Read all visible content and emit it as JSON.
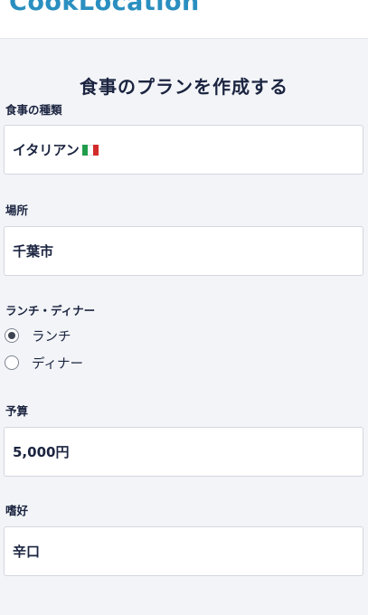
{
  "app": {
    "brand": "CookLocation"
  },
  "page": {
    "title": "食事のプランを作成する"
  },
  "form": {
    "cuisine": {
      "label": "食事の種類",
      "value": "イタリアン",
      "flag_icon": "italy-flag-icon"
    },
    "location": {
      "label": "場所",
      "value": "千葉市"
    },
    "meal_time": {
      "label": "ランチ・ディナー",
      "options": [
        {
          "label": "ランチ",
          "selected": true
        },
        {
          "label": "ディナー",
          "selected": false
        }
      ]
    },
    "budget": {
      "label": "予算",
      "value": "5,000円"
    },
    "preference": {
      "label": "嗜好",
      "value": "辛口"
    }
  },
  "colors": {
    "brand": "#2a8fc0",
    "background": "#f2f4f7",
    "text": "#1b2440",
    "input_border": "#d3d7de"
  }
}
